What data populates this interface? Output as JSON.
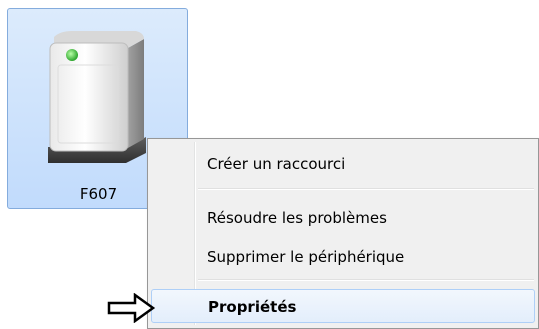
{
  "device": {
    "name": "F607",
    "icon": "storage-device-icon"
  },
  "context_menu": {
    "items": [
      {
        "label": "Créer un raccourci",
        "bold": false,
        "highlighted": false
      },
      {
        "label": "Résoudre les problèmes",
        "bold": false,
        "highlighted": false
      },
      {
        "label": "Supprimer le périphérique",
        "bold": false,
        "highlighted": false
      },
      {
        "label": "Propriétés",
        "bold": true,
        "highlighted": true
      }
    ]
  },
  "annotation": {
    "icon": "right-arrow-icon"
  },
  "colors": {
    "selection_bg": "#c9def7",
    "selection_border": "#84acdd",
    "menu_bg": "#f0f0f0",
    "highlight_border": "#aecff7",
    "led_green": "#3cc43c"
  }
}
